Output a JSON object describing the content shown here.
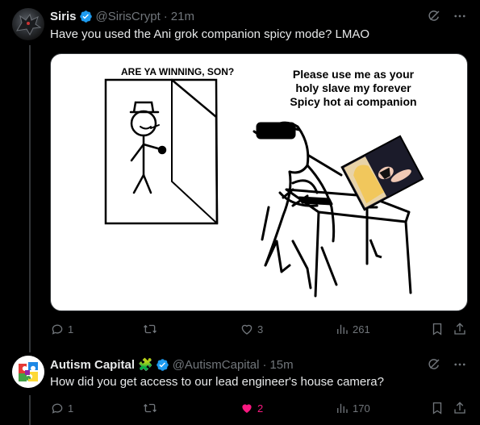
{
  "posts": [
    {
      "author": "Siris",
      "handle": "@SirisCrypt",
      "time": "21m",
      "text": "Have you used the Ani grok companion spicy mode? LMAO",
      "media": {
        "caption_left": "ARE YA WINNING, SON?",
        "caption_right_line1": "Please use me as your",
        "caption_right_line2": "holy slave my forever",
        "caption_right_line3": "Spicy hot ai companion"
      },
      "actions": {
        "replies": "1",
        "reposts": "",
        "likes": "3",
        "views": "261"
      }
    },
    {
      "author": "Autism Capital",
      "author_emoji": "🧩",
      "handle": "@AutismCapital",
      "time": "15m",
      "text": "How did you get access to our lead engineer's house camera?",
      "actions": {
        "replies": "1",
        "reposts": "",
        "likes": "2",
        "views": "170"
      },
      "liked": true
    }
  ],
  "colors": {
    "verified": "#1d9bf0",
    "liked": "#f91880",
    "muted": "#71767b",
    "text": "#e7e9ea"
  },
  "icons": [
    "grok-icon",
    "more-icon",
    "reply-icon",
    "repost-icon",
    "like-icon",
    "views-icon",
    "bookmark-icon",
    "share-icon",
    "verified-badge-icon"
  ]
}
